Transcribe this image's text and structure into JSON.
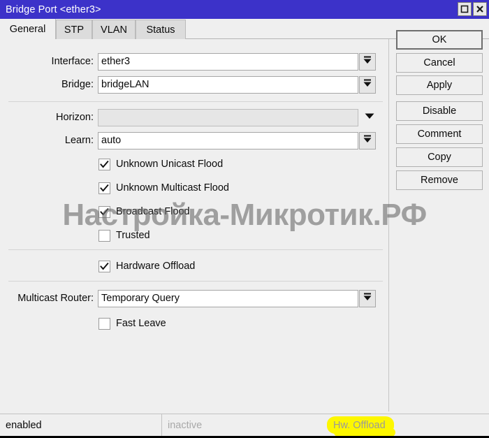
{
  "window": {
    "title": "Bridge Port <ether3>",
    "title_bar_color": "#3c32c9",
    "buttons": [
      {
        "name": "maximize-button",
        "icon": "maximize-icon"
      },
      {
        "name": "close-button",
        "icon": "close-icon"
      }
    ]
  },
  "tabs": [
    {
      "label": "General",
      "active": true
    },
    {
      "label": "STP",
      "active": false
    },
    {
      "label": "VLAN",
      "active": false
    },
    {
      "label": "Status",
      "active": false
    }
  ],
  "fields": [
    {
      "label": "Interface:",
      "value": "ether3",
      "placeholder": "",
      "disabled": false,
      "control": "dropdown-button"
    },
    {
      "label": "Bridge:",
      "value": "bridgeLAN",
      "placeholder": "",
      "disabled": false,
      "control": "dropdown-button"
    },
    {
      "label": "Horizon:",
      "value": "",
      "placeholder": "",
      "disabled": true,
      "control": "plain-caret"
    },
    {
      "label": "Learn:",
      "value": "auto",
      "placeholder": "",
      "disabled": false,
      "control": "dropdown-button"
    },
    {
      "label": "Multicast Router:",
      "value": "Temporary Query",
      "placeholder": "",
      "disabled": false,
      "control": "dropdown-button"
    }
  ],
  "checkboxes": [
    {
      "label": "Unknown Unicast Flood",
      "checked": true
    },
    {
      "label": "Unknown Multicast Flood",
      "checked": true
    },
    {
      "label": "Broadcast Flood",
      "checked": true
    },
    {
      "label": "Trusted",
      "checked": false
    },
    {
      "label": "Hardware Offload",
      "checked": true
    },
    {
      "label": "Fast Leave",
      "checked": false
    }
  ],
  "side_buttons": [
    {
      "label": "OK",
      "primary": true
    },
    {
      "label": "Cancel",
      "primary": false
    },
    {
      "label": "Apply",
      "primary": false
    },
    {
      "label": "Disable",
      "primary": false
    },
    {
      "label": "Comment",
      "primary": false
    },
    {
      "label": "Copy",
      "primary": false
    },
    {
      "label": "Remove",
      "primary": false
    }
  ],
  "status_bar": {
    "enabled": "enabled",
    "inactive": "inactive",
    "hw_offload": "Hw. Offload",
    "highlight_color": "#fdf700"
  },
  "watermark": {
    "text": "Настройка-Микротик.РФ"
  }
}
